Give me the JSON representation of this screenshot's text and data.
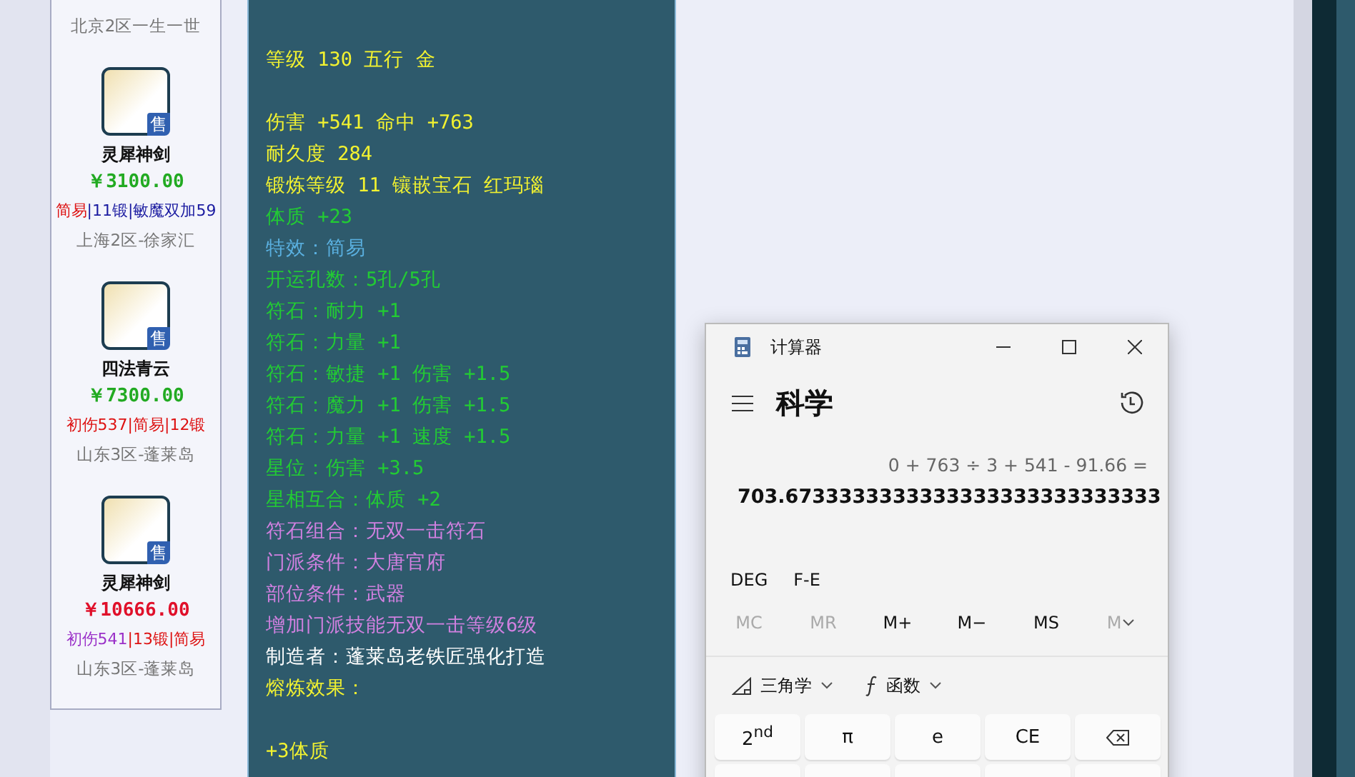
{
  "listings": [
    {
      "server": "北京2区一生一世"
    },
    {
      "badge": "售",
      "name": "灵犀神剑",
      "price": {
        "text": "￥3100.00",
        "color": "#22aa22"
      },
      "tags": [
        {
          "text": "简易",
          "color": "#dd1111"
        },
        {
          "text": "|11锻",
          "color": "#1a1aa0"
        },
        {
          "text": "|敏魔双加59",
          "color": "#1a1aa0"
        }
      ],
      "server": "上海2区-徐家汇"
    },
    {
      "badge": "售",
      "name": "四法青云",
      "price": {
        "text": "￥7300.00",
        "color": "#22aa22"
      },
      "tags": [
        {
          "text": "初伤537",
          "color": "#dd1111"
        },
        {
          "text": "|简易",
          "color": "#dd1111"
        },
        {
          "text": "|12锻",
          "color": "#dd1111"
        }
      ],
      "server": "山东3区-蓬莱岛"
    },
    {
      "badge": "售",
      "name": "灵犀神剑",
      "price": {
        "text": "￥10666.00",
        "color": "#e0102a"
      },
      "tags": [
        {
          "text": "初伤541",
          "color": "#9a30c8"
        },
        {
          "text": "|13锻",
          "color": "#dd1111"
        },
        {
          "text": "|简易",
          "color": "#dd1111"
        }
      ],
      "server": "山东3区-蓬莱岛"
    }
  ],
  "tooltip": {
    "lines": [
      {
        "text": "等级 130 五行 金",
        "color": "#f2f230",
        "spaced": false
      },
      {
        "text": "伤害 +541 命中 +763",
        "color": "#f2f230",
        "spaced": true
      },
      {
        "text": "耐久度 284",
        "color": "#f2f230",
        "spaced": false
      },
      {
        "text": "锻炼等级 11 镶嵌宝石 红玛瑙",
        "color": "#f2f230",
        "spaced": false
      },
      {
        "text": "体质 +23",
        "color": "#22cc33",
        "spaced": false
      },
      {
        "text": "特效：简易",
        "color": "#5ab0e0",
        "spaced": false
      },
      {
        "text": "开运孔数：5孔/5孔",
        "color": "#22cc33",
        "spaced": false
      },
      {
        "text": "符石：耐力 +1",
        "color": "#22cc33",
        "spaced": false
      },
      {
        "text": "符石：力量 +1",
        "color": "#22cc33",
        "spaced": false
      },
      {
        "text": "符石：敏捷 +1 伤害 +1.5",
        "color": "#22cc33",
        "spaced": false
      },
      {
        "text": "符石：魔力 +1 伤害 +1.5",
        "color": "#22cc33",
        "spaced": false
      },
      {
        "text": "符石：力量 +1 速度 +1.5",
        "color": "#22cc33",
        "spaced": false
      },
      {
        "text": "星位：伤害 +3.5",
        "color": "#22cc33",
        "spaced": false
      },
      {
        "text": "星相互合：体质 +2",
        "color": "#22cc33",
        "spaced": false
      },
      {
        "text": "符石组合：无双一击符石",
        "color": "#d080e0",
        "spaced": false
      },
      {
        "text": "门派条件：大唐官府",
        "color": "#d080e0",
        "spaced": false
      },
      {
        "text": "部位条件：武器",
        "color": "#d080e0",
        "spaced": false
      },
      {
        "text": "增加门派技能无双一击等级6级",
        "color": "#d080e0",
        "spaced": false
      },
      {
        "text": "制造者：蓬莱岛老铁匠强化打造",
        "color": "#ffffff",
        "spaced": false
      },
      {
        "text": "熔炼效果：",
        "color": "#f2f230",
        "spaced": false
      },
      {
        "text": "+3体质",
        "color": "#f2f230",
        "spaced": true
      }
    ]
  },
  "calculator": {
    "title": "计算器",
    "mode": "科学",
    "expression": "0 + 763 ÷ 3 + 541 - 91.66 =",
    "result": "703.6733333333333333333333333333",
    "settings": [
      "DEG",
      "F-E"
    ],
    "memory": [
      {
        "label": "MC",
        "disabled": true
      },
      {
        "label": "MR",
        "disabled": true
      },
      {
        "label": "M+",
        "disabled": false
      },
      {
        "label": "M−",
        "disabled": false
      },
      {
        "label": "MS",
        "disabled": false
      },
      {
        "label": "M",
        "disabled": true,
        "kind": "menu"
      }
    ],
    "menus": [
      {
        "label": "三角学",
        "kind": "trig"
      },
      {
        "label": "函数",
        "kind": "func"
      }
    ],
    "keys": [
      {
        "label": "2$^{nd}$",
        "kind": "text"
      },
      {
        "label": "π",
        "kind": "text"
      },
      {
        "label": "e",
        "kind": "text"
      },
      {
        "label": "CE",
        "kind": "text"
      },
      {
        "kind": "backspace"
      }
    ]
  }
}
